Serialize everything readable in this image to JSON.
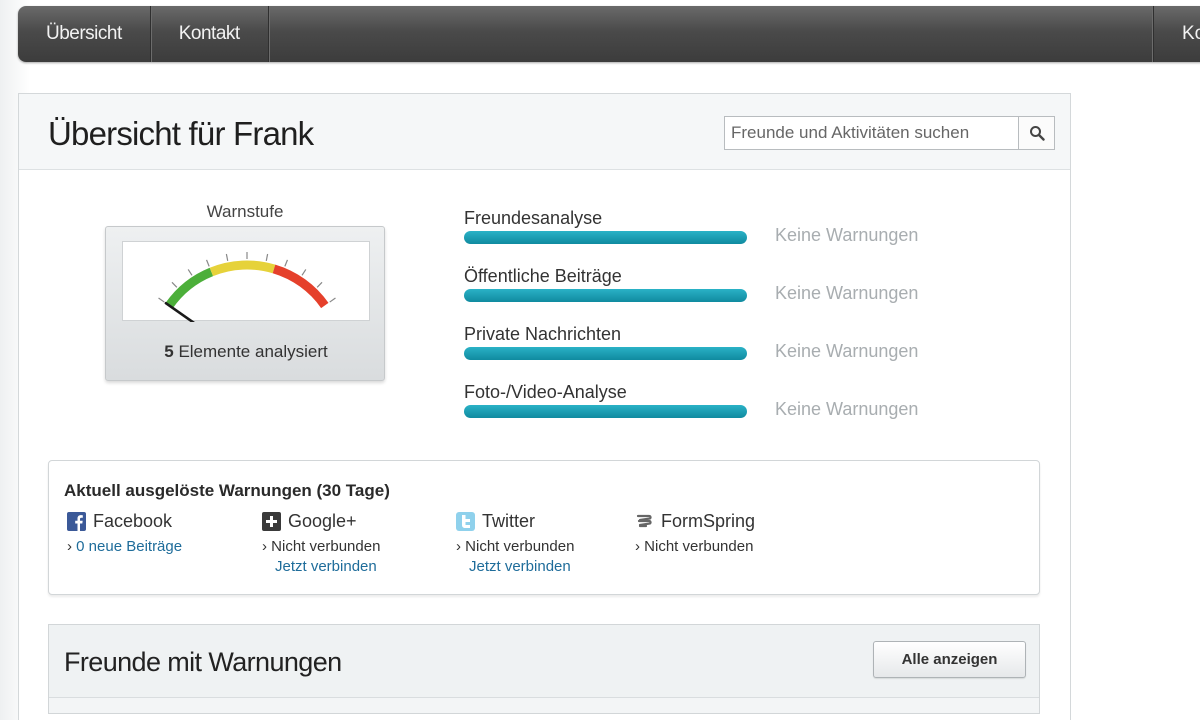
{
  "nav": {
    "items": [
      "Übersicht",
      "Kontakt"
    ],
    "right_item": "Ko"
  },
  "header": {
    "title": "Übersicht für Frank",
    "search_placeholder": "Freunde und Aktivitäten suchen"
  },
  "gauge": {
    "title": "Warnstufe",
    "count": "5",
    "caption_rest": " Elemente analysiert",
    "level_fraction": 0.0
  },
  "categories": [
    {
      "label": "Freundesanalyse",
      "status": "Keine Warnungen"
    },
    {
      "label": "Öffentliche Beiträge",
      "status": "Keine Warnungen"
    },
    {
      "label": "Private Nachrichten",
      "status": "Keine Warnungen"
    },
    {
      "label": "Foto-/Video-Analyse",
      "status": "Keine Warnungen"
    }
  ],
  "warnings": {
    "title": "Aktuell ausgelöste Warnungen (30 Tage)",
    "networks": [
      {
        "name": "Facebook",
        "icon": "facebook-icon",
        "line": "0 neue Beiträge",
        "link": true,
        "sub": ""
      },
      {
        "name": "Google+",
        "icon": "google-plus-icon",
        "line": "Nicht verbunden",
        "link": false,
        "sub": "Jetzt verbinden"
      },
      {
        "name": "Twitter",
        "icon": "twitter-icon",
        "line": "Nicht verbunden",
        "link": false,
        "sub": "Jetzt verbinden"
      },
      {
        "name": "FormSpring",
        "icon": "formspring-icon",
        "line": "Nicht verbunden",
        "link": false,
        "sub": ""
      }
    ]
  },
  "friends": {
    "title": "Freunde mit Warnungen",
    "show_all_label": "Alle anzeigen"
  },
  "colors": {
    "accent_bar": "#1a9fb4",
    "link": "#1e6c9a",
    "status_muted": "#a8adb0",
    "gauge_green": "#4caf3a",
    "gauge_yellow": "#e6d23a",
    "gauge_red": "#e5402b"
  }
}
